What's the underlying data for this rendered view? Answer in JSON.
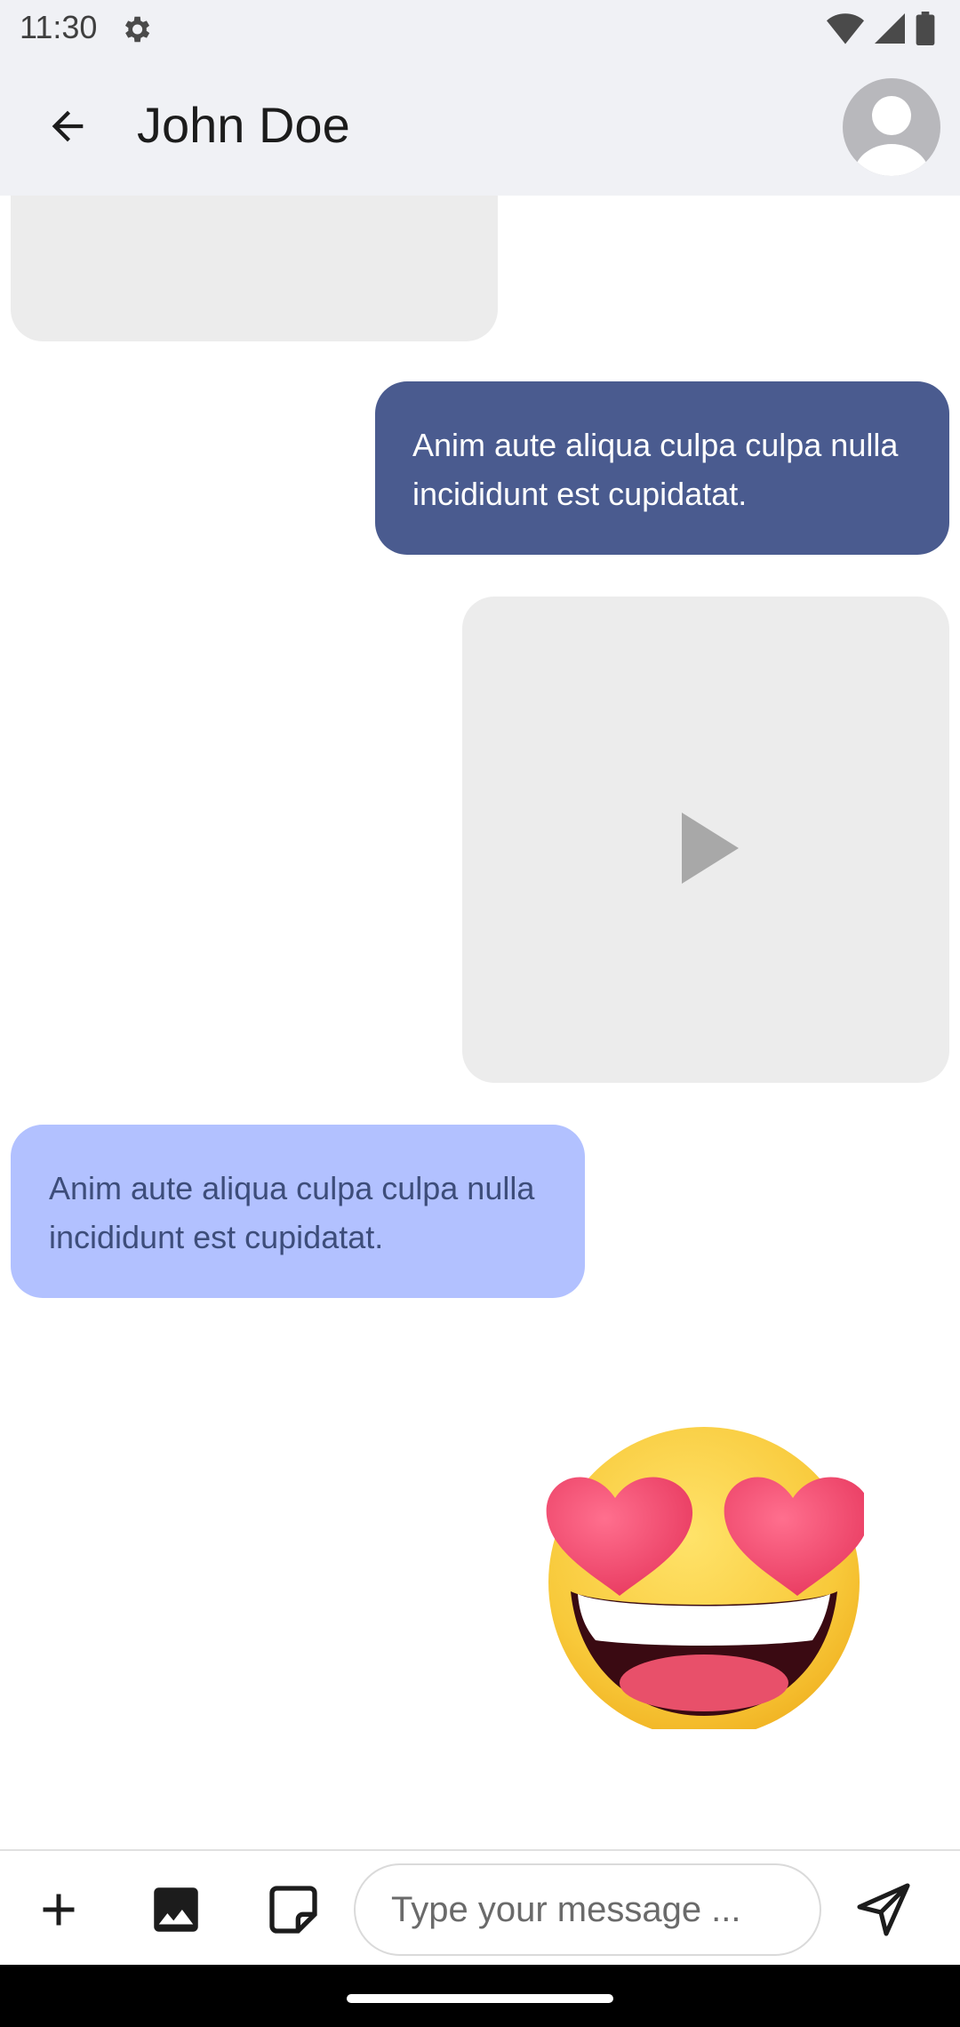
{
  "status_bar": {
    "time": "11:30",
    "settings_icon": "gear-icon",
    "wifi_icon": "wifi-icon",
    "signal_icon": "signal-icon",
    "battery_icon": "battery-icon"
  },
  "app_bar": {
    "title": "John Doe",
    "back_icon": "arrow-back-icon",
    "avatar_icon": "person-avatar-icon"
  },
  "messages": [
    {
      "type": "image",
      "direction": "incoming",
      "content": ""
    },
    {
      "type": "text",
      "direction": "outgoing",
      "text": "Anim aute aliqua culpa culpa nulla incididunt est cupidatat."
    },
    {
      "type": "video",
      "direction": "outgoing",
      "icon": "play-icon"
    },
    {
      "type": "text",
      "direction": "incoming",
      "text": "Anim aute aliqua culpa culpa nulla incididunt est cupidatat."
    },
    {
      "type": "sticker",
      "direction": "outgoing",
      "icon": "heart-eyes-emoji-icon"
    }
  ],
  "input_bar": {
    "add_icon": "plus-icon",
    "image_icon": "image-icon",
    "sticker_icon": "sticker-icon",
    "placeholder": "Type your message ...",
    "value": "",
    "send_icon": "send-icon"
  },
  "colors": {
    "app_bar_bg": "#f0f1f5",
    "outgoing_bubble": "#4a5b8f",
    "incoming_bubble": "#b2c1ff",
    "media_placeholder": "#ececec"
  }
}
